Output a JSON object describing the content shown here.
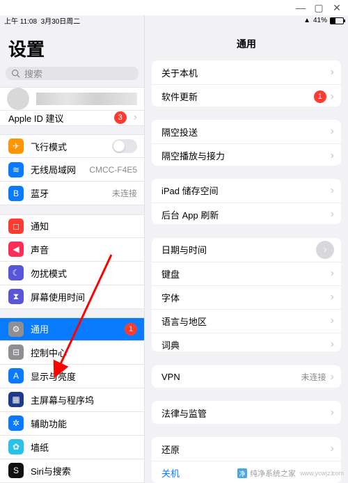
{
  "titlebar": {
    "min": "—",
    "max": "▢",
    "close": "✕"
  },
  "status": {
    "time": "上午 11:08",
    "date": "3月30日周二",
    "battery_pct": "41%",
    "charging": true
  },
  "left": {
    "title": "设置",
    "search_placeholder": "搜索",
    "apple_id": {
      "label": "Apple ID 建议",
      "badge": "3"
    },
    "items": [
      {
        "icon_bg": "#ff9500",
        "icon": "✈",
        "label": "飞行模式",
        "toggle": true
      },
      {
        "icon_bg": "#0a7bff",
        "icon": "≋",
        "label": "无线局域网",
        "value": "CMCC-F4E5"
      },
      {
        "icon_bg": "#0a7bff",
        "icon": "B",
        "label": "蓝牙",
        "value": "未连接"
      }
    ],
    "items2": [
      {
        "icon_bg": "#ff3b30",
        "icon": "◻",
        "label": "通知"
      },
      {
        "icon_bg": "#ff2d55",
        "icon": "◀",
        "label": "声音"
      },
      {
        "icon_bg": "#5856d6",
        "icon": "☾",
        "label": "勿扰模式"
      },
      {
        "icon_bg": "#5856d6",
        "icon": "⧗",
        "label": "屏幕使用时间"
      }
    ],
    "items3": [
      {
        "icon_bg": "#8e8e93",
        "icon": "⚙",
        "label": "通用",
        "badge": "1",
        "selected": true
      },
      {
        "icon_bg": "#8e8e93",
        "icon": "⊟",
        "label": "控制中心"
      },
      {
        "icon_bg": "#0a7bff",
        "icon": "A",
        "label": "显示与亮度"
      },
      {
        "icon_bg": "#1e3a8a",
        "icon": "▦",
        "label": "主屏幕与程序坞"
      },
      {
        "icon_bg": "#0a7bff",
        "icon": "✲",
        "label": "辅助功能"
      },
      {
        "icon_bg": "#28c2e8",
        "icon": "✿",
        "label": "墙纸"
      },
      {
        "icon_bg": "#111",
        "icon": "S",
        "label": "Siri与搜索"
      }
    ]
  },
  "right": {
    "title": "通用",
    "g1": [
      {
        "label": "关于本机"
      },
      {
        "label": "软件更新",
        "badge": "1"
      }
    ],
    "g2": [
      {
        "label": "隔空投送"
      },
      {
        "label": "隔空播放与接力"
      }
    ],
    "g3": [
      {
        "label": "iPad 储存空间"
      },
      {
        "label": "后台 App 刷新"
      }
    ],
    "g4": [
      {
        "label": "日期与时间",
        "bigchev": true
      },
      {
        "label": "键盘"
      },
      {
        "label": "字体"
      },
      {
        "label": "语言与地区"
      },
      {
        "label": "词典"
      }
    ],
    "g5": [
      {
        "label": "VPN",
        "value": "未连接"
      }
    ],
    "g6": [
      {
        "label": "法律与监管"
      }
    ],
    "g7": [
      {
        "label": "还原"
      },
      {
        "label": "关机",
        "link": true
      }
    ]
  },
  "watermark": {
    "text": "纯净系统之家",
    "url": "www.ycwjz.com"
  }
}
